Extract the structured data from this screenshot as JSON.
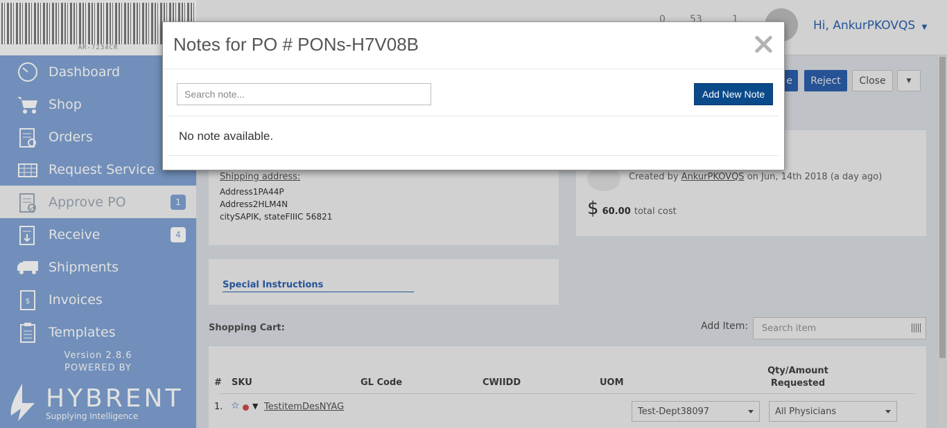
{
  "sidebar": {
    "barcode_text": "AR-7234CR",
    "items": [
      {
        "label": "Dashboard",
        "icon": "dashboard-icon"
      },
      {
        "label": "Shop",
        "icon": "cart-icon"
      },
      {
        "label": "Orders",
        "icon": "orders-icon"
      },
      {
        "label": "Request Service",
        "icon": "request-service-icon"
      },
      {
        "label": "Approve PO",
        "icon": "approve-po-icon",
        "badge": "1",
        "active": true
      },
      {
        "label": "Receive",
        "icon": "receive-icon",
        "badge": "4"
      },
      {
        "label": "Shipments",
        "icon": "truck-icon"
      },
      {
        "label": "Invoices",
        "icon": "invoice-icon"
      },
      {
        "label": "Templates",
        "icon": "templates-icon"
      }
    ],
    "version": "Version 2.8.6",
    "powered_by": "POWERED BY",
    "brand": "HYBRENT",
    "tagline": "Supplying Intelligence"
  },
  "header": {
    "count_1": "0",
    "count_2": "53",
    "count_3": "1",
    "greeting": "Hi, AnkurPKOVQS"
  },
  "actions": {
    "partial_label": "e",
    "reject": "Reject",
    "close": "Close"
  },
  "shipping": {
    "heading": "Shipping address:",
    "line1": "Address1PA44P",
    "line2": "Address2HLM4N",
    "line3": "citySAPIK, stateFIIIC 56821"
  },
  "summary": {
    "created_prefix": "Created by",
    "created_user": "AnkurPKOVQS",
    "created_suffix": "on Jun, 14th 2018 (a day ago)",
    "currency": "$",
    "amount": "60.00",
    "amount_label": "total cost"
  },
  "special_instructions": "Special Instructions",
  "cart": {
    "label": "Shopping Cart:",
    "add_item_label": "Add Item:",
    "search_placeholder": "Search item",
    "columns": {
      "num": "#",
      "sku": "SKU",
      "gl": "GL Code",
      "cwiidd": "CWIIDD",
      "uom": "UOM",
      "qty_1": "Qty/Amount",
      "qty_2": "Requested"
    },
    "row": {
      "num": "1.",
      "item": "TestitemDesNYAG",
      "dept": "Test-Dept38097",
      "physician": "All Physicians"
    }
  },
  "modal": {
    "title": "Notes for PO # PONs-H7V08B",
    "search_placeholder": "Search note...",
    "add_button": "Add New Note",
    "empty_text": "No note available."
  },
  "colors": {
    "sidebar": "#2f66b8",
    "primary_button": "#0b4a8a"
  }
}
